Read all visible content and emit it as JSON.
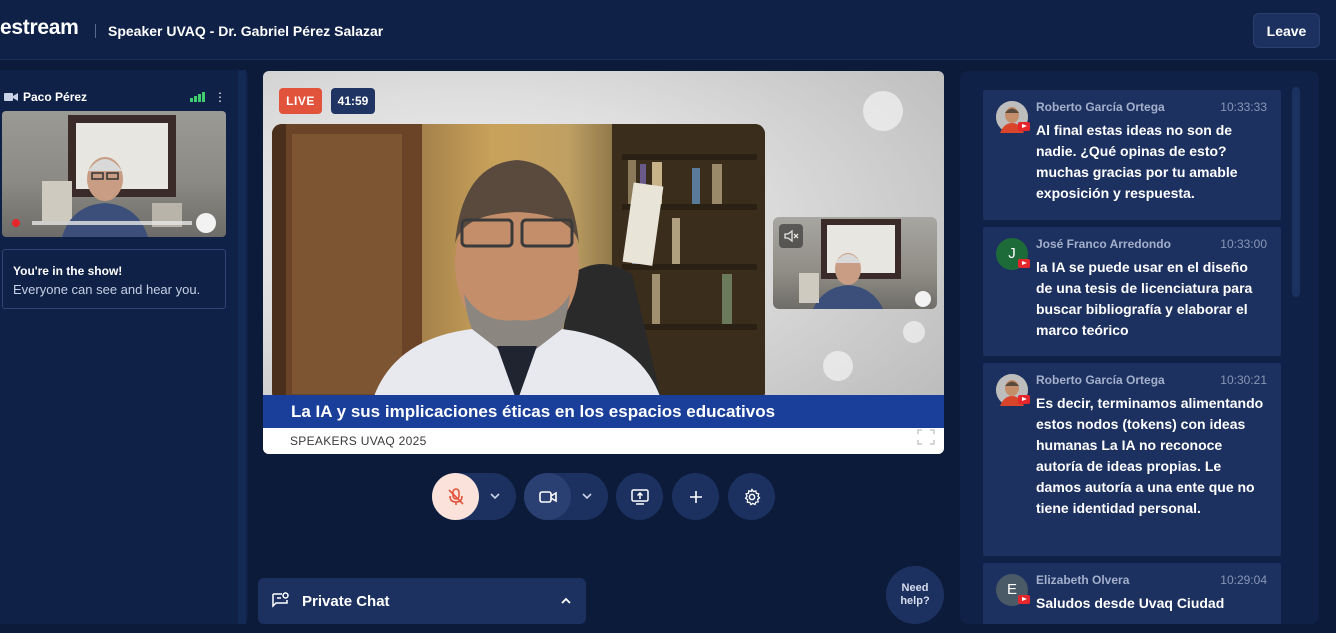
{
  "header": {
    "brand": "estream",
    "title": "Speaker UVAQ - Dr. Gabriel Pérez Salazar",
    "leave_label": "Leave"
  },
  "self_view": {
    "name": "Paco Pérez",
    "info_title": "You're in the show!",
    "info_text": "Everyone can see and hear you."
  },
  "stage": {
    "live_label": "LIVE",
    "timer": "41:59",
    "banner_title": "La IA y sus implicaciones éticas en los espacios educativos",
    "ticker": "SPEAKERS UVAQ 2025"
  },
  "controls": {
    "help_label_1": "Need",
    "help_label_2": "help?"
  },
  "private_chat": {
    "label": "Private Chat"
  },
  "comments": [
    {
      "author": "Roberto García Ortega",
      "time": "10:33:33",
      "avatar_initial": "",
      "avatar_color": "#8a8a8a",
      "text": "Al final estas ideas no son de nadie. ¿Qué opinas de esto? muchas gracias por tu amable exposición y respuesta."
    },
    {
      "author": "José Franco Arredondo",
      "time": "10:33:00",
      "avatar_initial": "J",
      "avatar_color": "#1e6b3a",
      "text": "la IA se puede usar en el diseño de una tesis de licenciatura para buscar bibliografía y elaborar el marco teórico"
    },
    {
      "author": "Roberto García Ortega",
      "time": "10:30:21",
      "avatar_initial": "",
      "avatar_color": "#8a8a8a",
      "text": "Es decir, terminamos alimentando estos nodos (tokens) con ideas humanas La IA no reconoce autoría de ideas propias. Le damos autoría a una ente que no tiene identidad personal."
    },
    {
      "author": "Elizabeth Olvera",
      "time": "10:29:04",
      "avatar_initial": "E",
      "avatar_color": "#4a5a66",
      "text": "Saludos desde Uvaq Ciudad"
    }
  ],
  "colors": {
    "background": "#0d1b3a",
    "panel": "#0f2147",
    "card": "#1d3160",
    "live": "#e2533b",
    "banner": "#1a3f9a",
    "mic_muted_bg": "#fbe3dc",
    "mic_muted_icon": "#e2533b",
    "youtube": "#e5262b"
  }
}
